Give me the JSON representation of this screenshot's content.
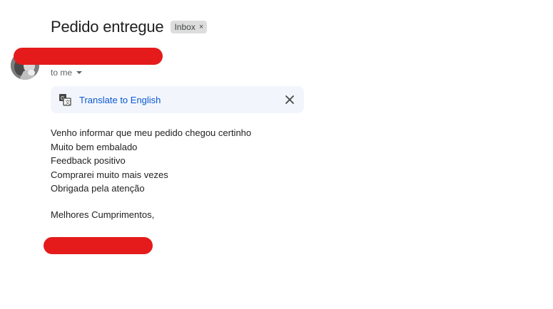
{
  "email": {
    "subject": "Pedido entregue",
    "label": "Inbox",
    "label_remove": "×",
    "recipient_summary": "to me",
    "translate_link": "Translate to English",
    "body_lines": [
      "Venho informar que meu pedido chegou certinho",
      "Muito bem embalado",
      "Feedback positivo",
      "Comprarei muito mais vezes",
      "Obrigada pela atenção"
    ],
    "closing": "Melhores Cumprimentos,"
  },
  "icons": {
    "translate": "translate-icon",
    "close": "close-icon",
    "dropdown": "caret-down-icon"
  },
  "colors": {
    "redaction": "#e51b1b",
    "link": "#0b57d0",
    "translate_bar_bg": "#f2f6fc",
    "label_chip_bg": "#dddddd"
  }
}
